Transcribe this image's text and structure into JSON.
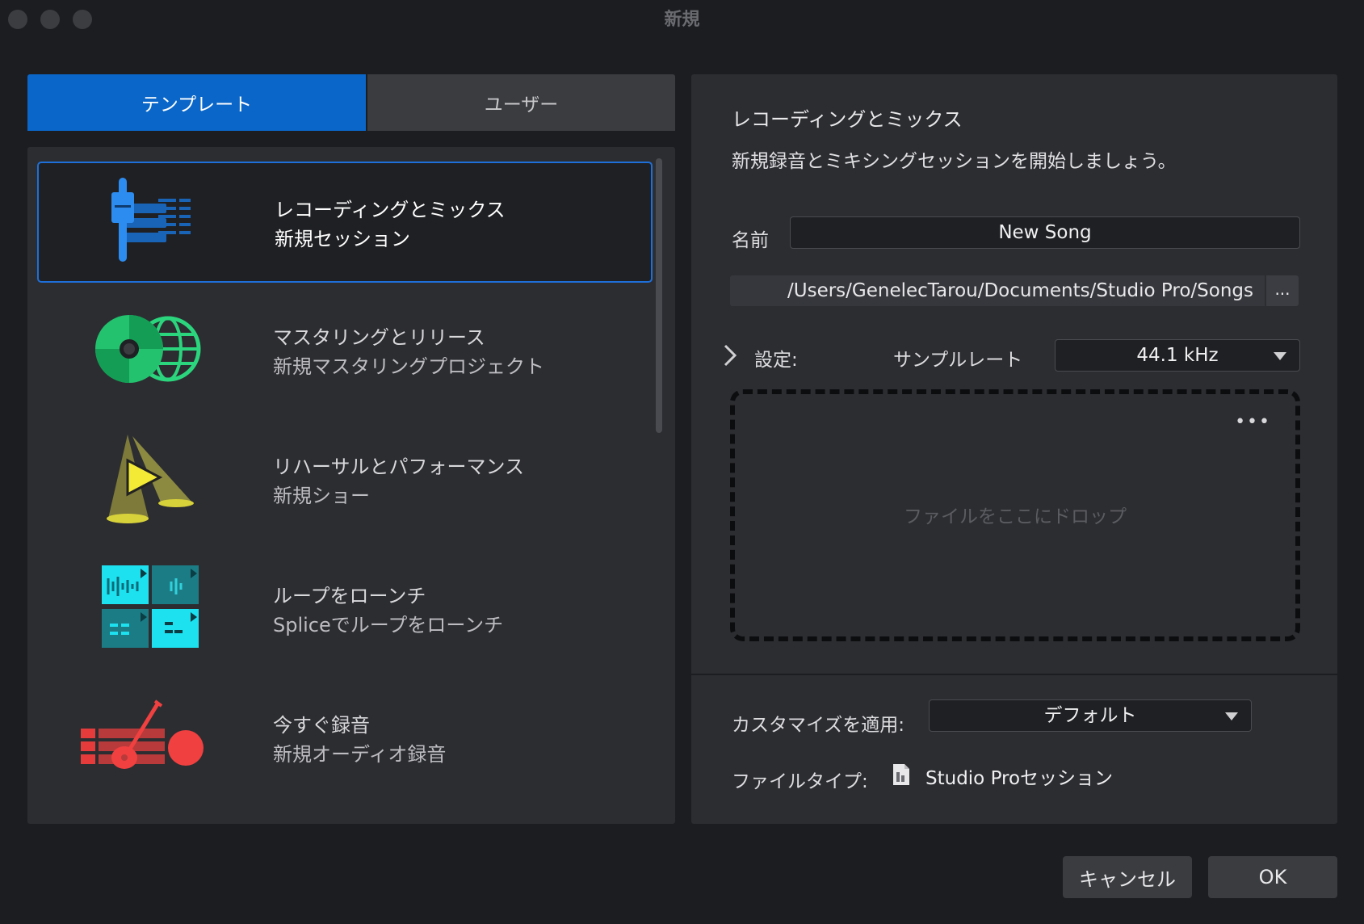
{
  "window": {
    "title": "新規"
  },
  "tabs": [
    {
      "label": "テンプレート",
      "active": true
    },
    {
      "label": "ユーザー",
      "active": false
    }
  ],
  "templates": [
    {
      "title": "レコーディングとミックス",
      "subtitle": "新規セッション",
      "icon": "mixer-fader-icon",
      "selected": true
    },
    {
      "title": "マスタリングとリリース",
      "subtitle": "新規マスタリングプロジェクト",
      "icon": "disc-globe-icon",
      "selected": false
    },
    {
      "title": "リハーサルとパフォーマンス",
      "subtitle": "新規ショー",
      "icon": "stage-spotlight-play-icon",
      "selected": false
    },
    {
      "title": "ループをローンチ",
      "subtitle": "Spliceでループをローンチ",
      "icon": "loop-grid-icon",
      "selected": false
    },
    {
      "title": "今すぐ録音",
      "subtitle": "新規オーディオ録音",
      "icon": "guitar-record-icon",
      "selected": false
    }
  ],
  "detail": {
    "title": "レコーディングとミックス",
    "description": "新規録音とミキシングセッションを開始しましょう。",
    "name_label": "名前",
    "name_value": "New Song",
    "path": "/Users/GenelecTarou/Documents/Studio Pro/Songs",
    "path_button": "...",
    "settings_label": "設定:",
    "sample_rate_label": "サンプルレート",
    "sample_rate_value": "44.1 kHz",
    "drop_more": "•••",
    "drop_text": "ファイルをここにドロップ",
    "customize_label": "カスタマイズを適用:",
    "customize_value": "デフォルト",
    "filetype_label": "ファイルタイプ:",
    "filetype_value": "Studio Proセッション"
  },
  "buttons": {
    "cancel": "キャンセル",
    "ok": "OK"
  },
  "colors": {
    "accent": "#0a66c8",
    "background": "#1c1d20",
    "panel": "#2c2d31"
  }
}
